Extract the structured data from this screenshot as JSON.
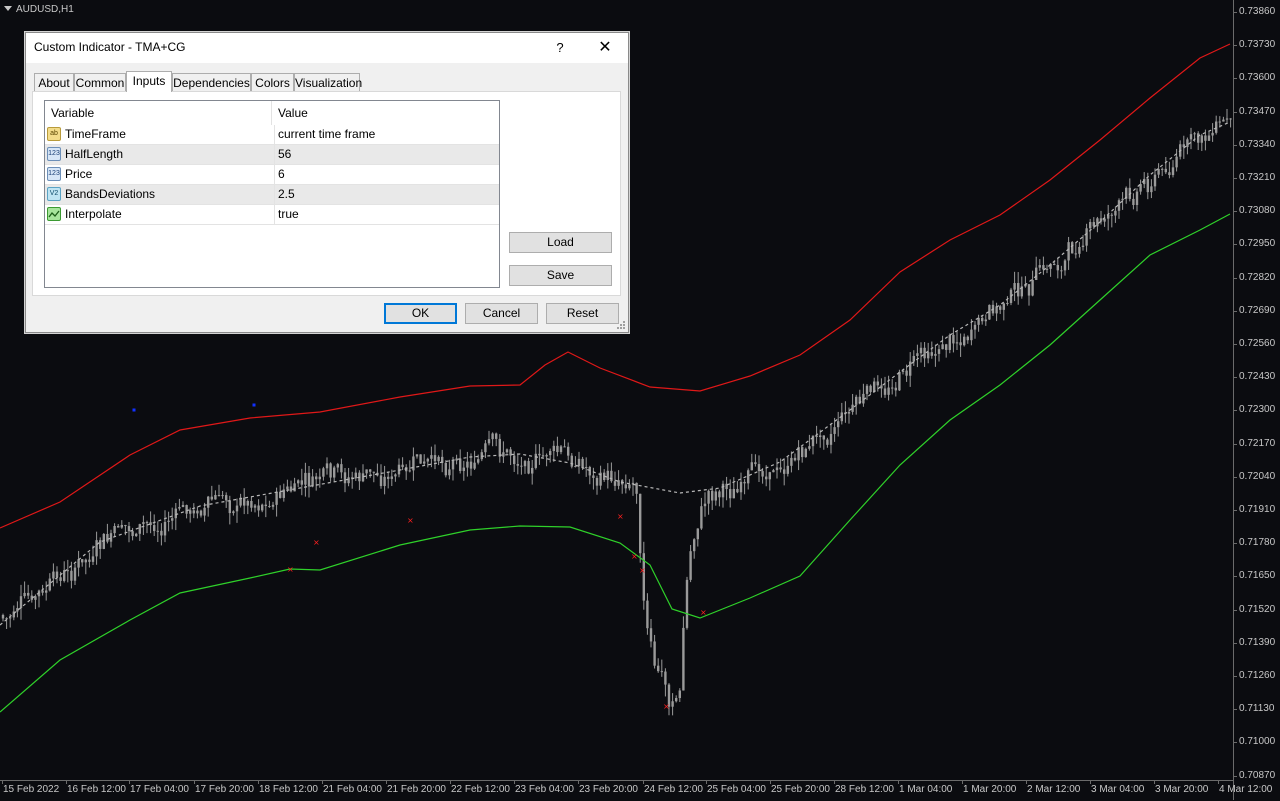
{
  "chart": {
    "symbol": "AUDUSD,H1",
    "price_labels": [
      "0.73860",
      "0.73730",
      "0.73600",
      "0.73470",
      "0.73340",
      "0.73210",
      "0.73080",
      "0.72950",
      "0.72820",
      "0.72690",
      "0.72560",
      "0.72430",
      "0.72300",
      "0.72170",
      "0.72040",
      "0.71910",
      "0.71780",
      "0.71650",
      "0.71520",
      "0.71390",
      "0.71260",
      "0.71130",
      "0.71000",
      "0.70870"
    ],
    "time_labels": [
      "15 Feb 2022",
      "16 Feb 12:00",
      "17 Feb 04:00",
      "17 Feb 20:00",
      "18 Feb 12:00",
      "21 Feb 04:00",
      "21 Feb 20:00",
      "22 Feb 12:00",
      "23 Feb 04:00",
      "23 Feb 20:00",
      "24 Feb 12:00",
      "25 Feb 04:00",
      "25 Feb 20:00",
      "28 Feb 12:00",
      "1 Mar 04:00",
      "1 Mar 20:00",
      "2 Mar 12:00",
      "3 Mar 04:00",
      "3 Mar 20:00",
      "4 Mar 12:00"
    ],
    "colors": {
      "background": "#0b0c10",
      "upper_band": "#e01818",
      "lower_band": "#2fd12a",
      "center_line": "#b8b8b8",
      "candles": "#9a9a9a",
      "signal_marker": "#ff2020",
      "dot_marker": "#1030ff"
    }
  },
  "dialog": {
    "title": "Custom Indicator - TMA+CG",
    "help_label": "?",
    "close_label": "✕",
    "tabs": [
      {
        "label": "About",
        "active": false
      },
      {
        "label": "Common",
        "active": false
      },
      {
        "label": "Inputs",
        "active": true
      },
      {
        "label": "Dependencies",
        "active": false
      },
      {
        "label": "Colors",
        "active": false
      },
      {
        "label": "Visualization",
        "active": false
      }
    ],
    "grid": {
      "col_variable": "Variable",
      "col_value": "Value",
      "rows": [
        {
          "icon": "string-type-icon",
          "icon_text": "ab",
          "variable": "TimeFrame",
          "value": "current time frame"
        },
        {
          "icon": "integer-type-icon",
          "icon_text": "123",
          "variable": "HalfLength",
          "value": "56"
        },
        {
          "icon": "integer-type-icon",
          "icon_text": "123",
          "variable": "Price",
          "value": "6"
        },
        {
          "icon": "double-type-icon",
          "icon_text": "V2",
          "variable": "BandsDeviations",
          "value": "2.5"
        },
        {
          "icon": "bool-type-icon",
          "icon_text": "",
          "variable": "Interpolate",
          "value": "true"
        }
      ]
    },
    "buttons": {
      "load": "Load",
      "save": "Save",
      "ok": "OK",
      "cancel": "Cancel",
      "reset": "Reset"
    }
  }
}
